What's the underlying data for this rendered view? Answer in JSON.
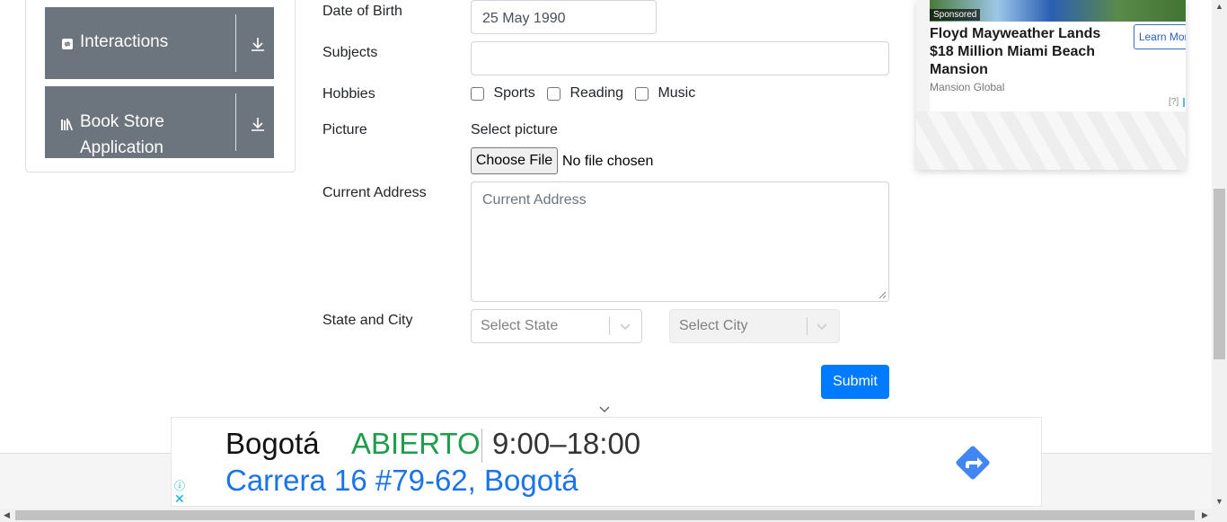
{
  "sidebar": {
    "groups": [
      {
        "label": "Interactions",
        "icon": "interactions-icon"
      },
      {
        "label": "Book Store Application",
        "label_line1": "Book Store",
        "label_line2": "Application",
        "icon": "book-icon"
      }
    ]
  },
  "form": {
    "dob": {
      "label": "Date of Birth",
      "value": "25 May 1990"
    },
    "subjects": {
      "label": "Subjects",
      "value": ""
    },
    "hobbies": {
      "label": "Hobbies",
      "options": [
        "Sports",
        "Reading",
        "Music"
      ]
    },
    "picture": {
      "label": "Picture",
      "hint": "Select picture",
      "button": "Choose File",
      "status": "No file chosen"
    },
    "address": {
      "label": "Current Address",
      "placeholder": "Current Address"
    },
    "state_city": {
      "label": "State and City",
      "state_placeholder": "Select State",
      "city_placeholder": "Select City"
    },
    "submit": "Submit"
  },
  "ad_right": {
    "sponsored": "Sponsored",
    "title": "Floyd Mayweather Lands $18 Million Miami Beach Mansion",
    "source": "Mansion Global",
    "cta": "Learn More",
    "info": "[?]"
  },
  "banner": {
    "city": "Bogotá",
    "status": "ABIERTO",
    "hours": "9:00–18:00",
    "address": "Carrera 16 #79-62, Bogotá",
    "info_icon": "ⓘ",
    "close_icon": "✕"
  },
  "colors": {
    "primary": "#007bff",
    "sidebar_bg": "#6c757d",
    "open_green": "#1e9e4a",
    "link_blue": "#1a73e8"
  }
}
